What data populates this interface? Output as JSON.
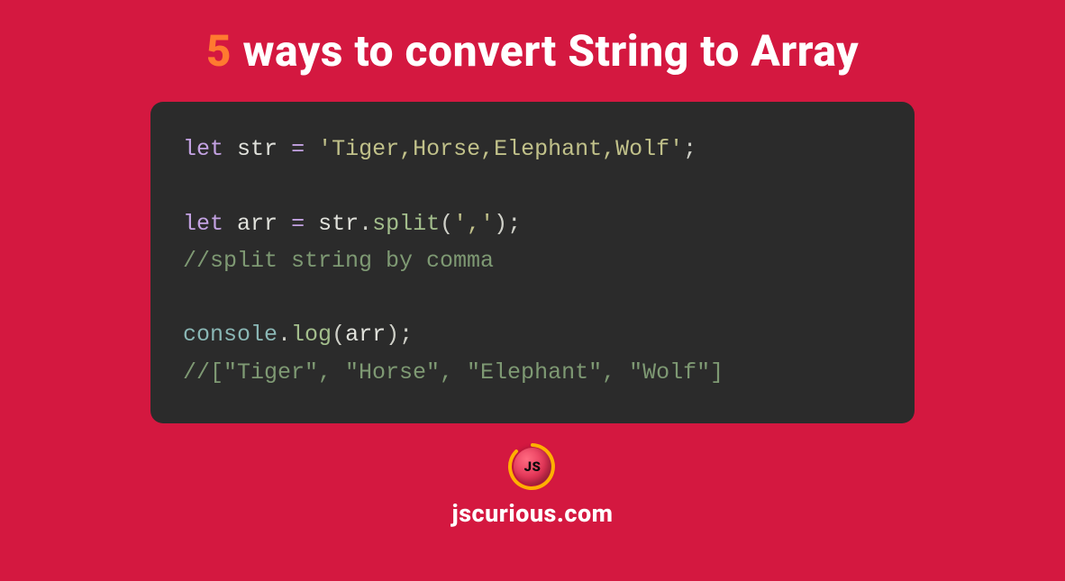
{
  "title": {
    "accent": "5",
    "rest": " ways to convert String to Array"
  },
  "code": {
    "line1": {
      "let": "let",
      "var": "str",
      "eq": "=",
      "str": "'Tiger,Horse,Elephant,Wolf'",
      "semi": ";"
    },
    "line2": {
      "let": "let",
      "var": "arr",
      "eq": "=",
      "obj": "str",
      "dot": ".",
      "method": "split",
      "open": "(",
      "arg": "','",
      "close": ")",
      "semi": ";"
    },
    "line3_comment": "//split string by comma",
    "line4": {
      "console": "console",
      "dot": ".",
      "log": "log",
      "open": "(",
      "arg": "arr",
      "close": ")",
      "semi": ";"
    },
    "line5_comment": "//[\"Tiger\", \"Horse\", \"Elephant\", \"Wolf\"]"
  },
  "footer": {
    "logo_text": "JS",
    "site": "jscurious.com"
  }
}
